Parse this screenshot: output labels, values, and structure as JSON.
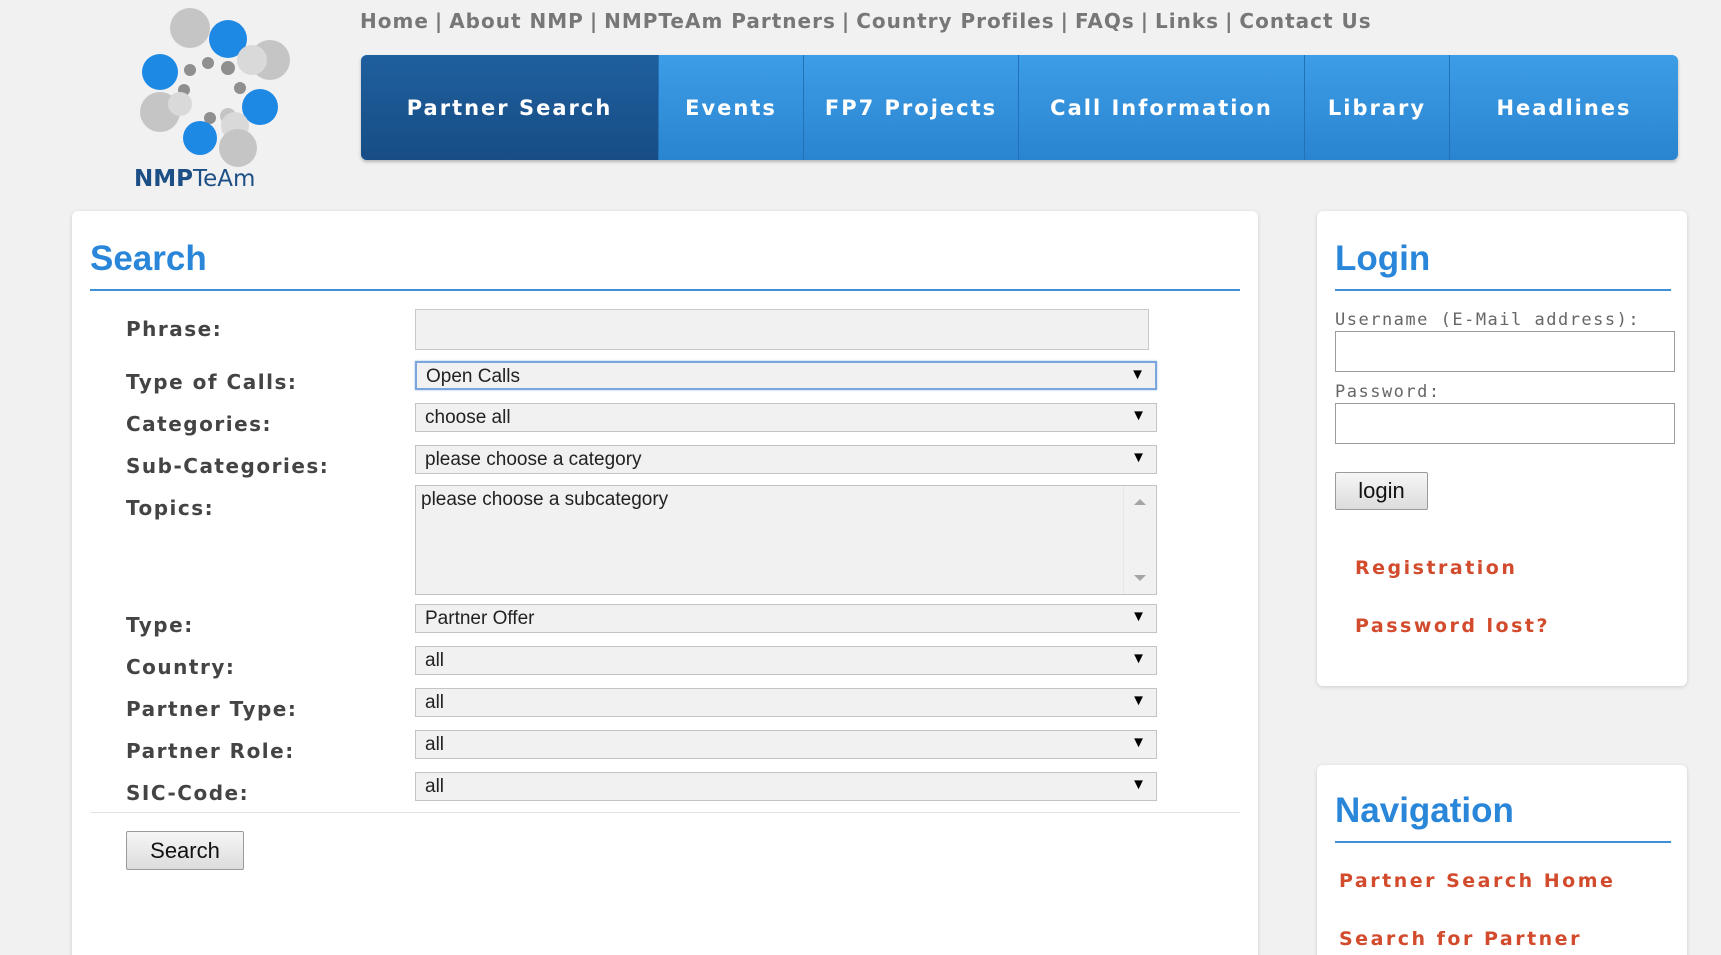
{
  "logo": {
    "text_bold": "NMP",
    "text_light": "TeAm"
  },
  "top_links": {
    "items": [
      "Home",
      "About NMP",
      "NMPTeAm Partners",
      "Country Profiles",
      "FAQs",
      "Links",
      "Contact Us"
    ],
    "separator": "|"
  },
  "nav": {
    "items": [
      {
        "label": "Partner Search",
        "active": true
      },
      {
        "label": "Events",
        "active": false
      },
      {
        "label": "FP7 Projects",
        "active": false
      },
      {
        "label": "Call Information",
        "active": false
      },
      {
        "label": "Library",
        "active": false
      },
      {
        "label": "Headlines",
        "active": false
      }
    ]
  },
  "search": {
    "title": "Search",
    "fields": {
      "phrase": {
        "label": "Phrase:",
        "value": ""
      },
      "type_of_calls": {
        "label": "Type of Calls:",
        "value": "Open Calls"
      },
      "categories": {
        "label": "Categories:",
        "value": "choose all"
      },
      "sub_categories": {
        "label": "Sub-Categories:",
        "value": "please choose a category"
      },
      "topics": {
        "label": "Topics:",
        "value": "please choose a subcategory"
      },
      "type": {
        "label": "Type:",
        "value": "Partner Offer"
      },
      "country": {
        "label": "Country:",
        "value": "all"
      },
      "partner_type": {
        "label": "Partner Type:",
        "value": "all"
      },
      "partner_role": {
        "label": "Partner Role:",
        "value": "all"
      },
      "sic_code": {
        "label": "SIC-Code:",
        "value": "all"
      }
    },
    "select_arrow": "▼",
    "button_label": "Search"
  },
  "login": {
    "title": "Login",
    "username_label": "Username (E-Mail address):",
    "password_label": "Password:",
    "button_label": "login",
    "registration_link": "Registration",
    "password_lost_link": "Password lost?"
  },
  "navigation": {
    "title": "Navigation",
    "links": [
      "Partner Search Home",
      "Search for Partner"
    ]
  },
  "colors": {
    "accent_blue": "#2a86d8",
    "nav_blue": "#2a84d0",
    "nav_active": "#174d85",
    "link_red": "#d24b2c",
    "page_bg": "#f1f1f1"
  }
}
